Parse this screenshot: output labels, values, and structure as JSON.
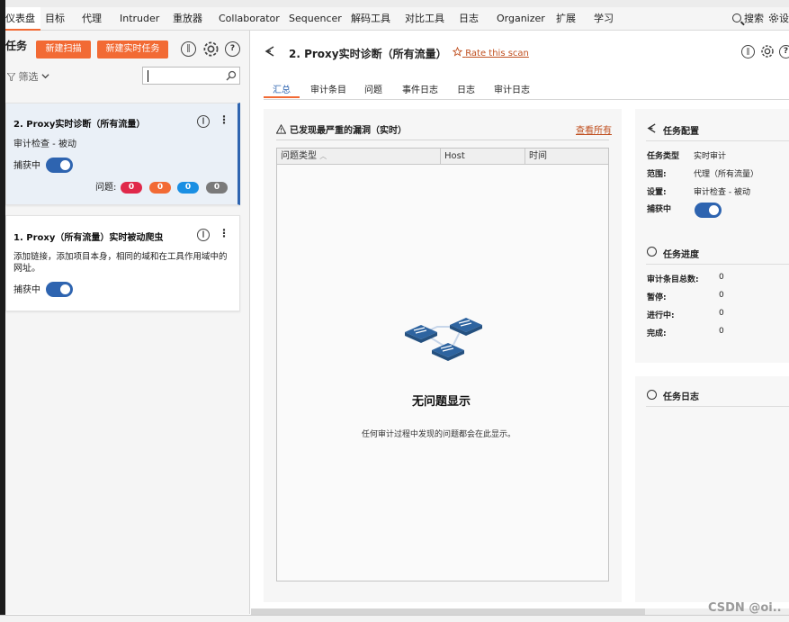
{
  "menu": {
    "items": [
      "仪表盘",
      "目标",
      "代理",
      "Intruder",
      "重放器",
      "Collaborator",
      "Sequencer",
      "解码工具",
      "对比工具",
      "日志",
      "Organizer",
      "扩展",
      "学习"
    ],
    "search_label": "搜索",
    "settings_label": "设"
  },
  "left": {
    "title": "任务",
    "new_scan": "新建扫描",
    "new_live_task": "新建实时任务",
    "filter_label": "筛选",
    "tasks": [
      {
        "title": "2. Proxy实时诊断（所有流量）",
        "subtitle": "审计检查 - 被动",
        "capture_label": "捕获中",
        "issues_label": "问题:",
        "counts": [
          "0",
          "0",
          "0",
          "0"
        ]
      },
      {
        "title": "1. Proxy（所有流量）实时被动爬虫",
        "desc_line1": "添加链接，添加项目本身，相同的域和在工具作用域中的",
        "desc_line2": "网址。",
        "capture_label": "捕获中"
      }
    ]
  },
  "right": {
    "title": "2. Proxy实时诊断（所有流量）",
    "rate": "Rate this scan",
    "tabs": [
      "汇总",
      "审计条目",
      "问题",
      "事件日志",
      "日志",
      "审计日志"
    ],
    "issues": {
      "heading": "已发现最严重的漏洞（实时）",
      "view_all": "查看所有",
      "columns": [
        "问题类型",
        "Host",
        "时间"
      ],
      "empty_title": "无问题显示",
      "empty_text": "任何审计过程中发现的问题都会在此显示。"
    },
    "config": {
      "title": "任务配置",
      "rows": [
        {
          "k": "任务类型",
          "v": "实时审计"
        },
        {
          "k": "范围:",
          "v": "代理（所有流量）"
        },
        {
          "k": "设置:",
          "v": "审计检查 - 被动"
        }
      ],
      "capture_label": "捕获中"
    },
    "progress": {
      "title": "任务进度",
      "rows": [
        {
          "k": "审计条目总数:",
          "v": "0"
        },
        {
          "k": "暂停:",
          "v": "0"
        },
        {
          "k": "进行中:",
          "v": "0"
        },
        {
          "k": "完成:",
          "v": "0"
        }
      ]
    },
    "log": {
      "title": "任务日志"
    }
  },
  "watermark": "CSDN @oi..",
  "colors": {
    "accent": "#f26a34",
    "toggle": "#2e64b0",
    "red": "#e0284a",
    "orange": "#f26a34",
    "blue": "#1a8fe3",
    "gray": "#7a7a7a"
  }
}
